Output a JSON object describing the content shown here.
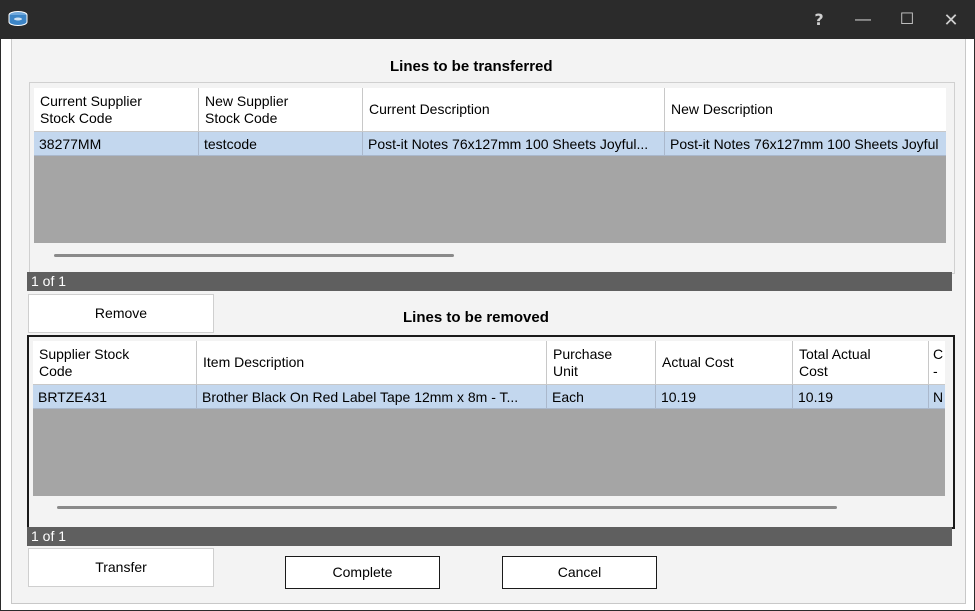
{
  "window": {
    "app_icon": "database-icon",
    "controls": {
      "help": "?",
      "minimize": "—",
      "maximize": "☐",
      "close": "✕"
    }
  },
  "transferred": {
    "title": "Lines to be transferred",
    "columns": [
      {
        "label": "Current Supplier\nStock Code"
      },
      {
        "label": "New Supplier\nStock Code"
      },
      {
        "label": "Current Description"
      },
      {
        "label": "New Description"
      }
    ],
    "rows": [
      [
        "38277MM",
        "testcode",
        "Post-it Notes 76x127mm 100 Sheets Joyful...",
        "Post-it Notes 76x127mm 100 Sheets Joyful"
      ]
    ],
    "pager": "1 of 1"
  },
  "remove_button": "Remove",
  "removed": {
    "title": "Lines to be removed",
    "columns": [
      {
        "label": "Supplier Stock\nCode"
      },
      {
        "label": "Item Description"
      },
      {
        "label": "Purchase\nUnit"
      },
      {
        "label": "Actual Cost"
      },
      {
        "label": "Total Actual\nCost"
      },
      {
        "label": "C\n-"
      }
    ],
    "rows": [
      [
        "BRTZE431",
        "Brother Black On Red Label Tape 12mm x 8m - T...",
        "Each",
        "10.19",
        "10.19",
        "N"
      ]
    ],
    "pager": "1 of 1"
  },
  "buttons": {
    "transfer": "Transfer",
    "complete": "Complete",
    "cancel": "Cancel"
  }
}
